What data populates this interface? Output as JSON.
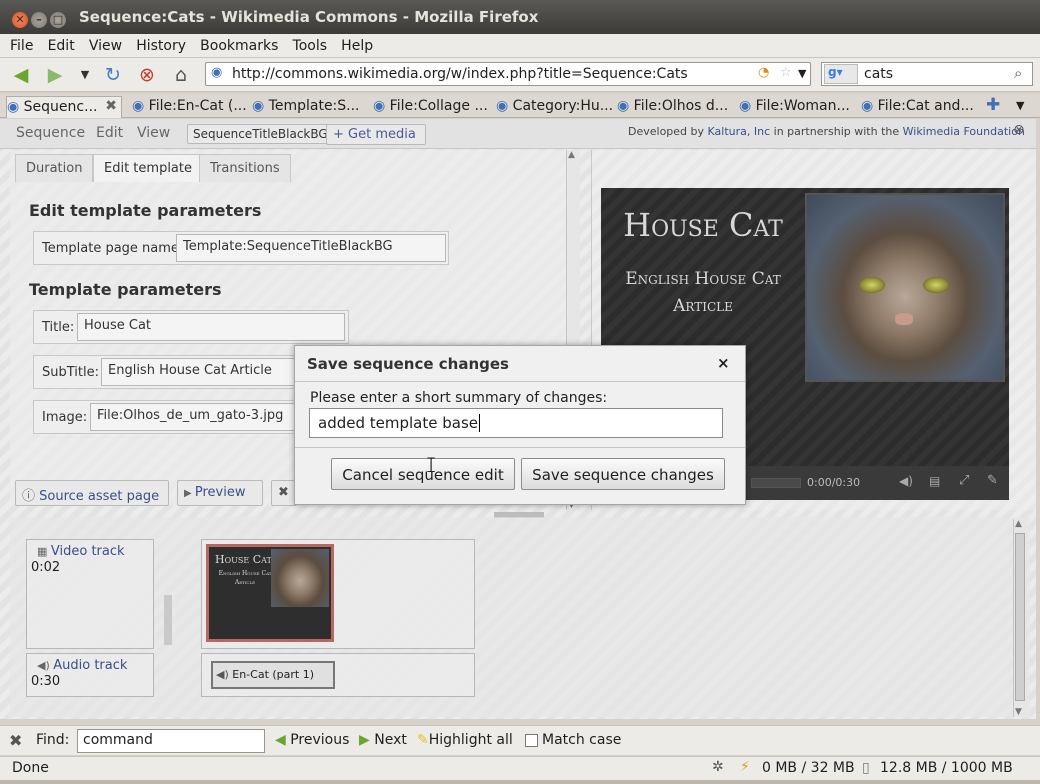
{
  "window": {
    "title": "Sequence:Cats - Wikimedia Commons - Mozilla Firefox"
  },
  "menu": [
    "File",
    "Edit",
    "View",
    "History",
    "Bookmarks",
    "Tools",
    "Help"
  ],
  "nav": {
    "url": "http://commons.wikimedia.org/w/index.php?title=Sequence:Cats",
    "search_value": "cats"
  },
  "tabs": [
    "Sequenc...",
    "File:En-Cat (...",
    "Template:S...",
    "File:Collage ...",
    "Category:Hu...",
    "File:Olhos d...",
    "File:Woman...",
    "File:Cat and..."
  ],
  "editor": {
    "menus": [
      "Sequence",
      "Edit",
      "View"
    ],
    "template_label": "SequenceTitleBlackBG",
    "get_media": "+ Get media",
    "credit": {
      "prefix": "Developed by",
      "kaltura": "Kaltura, Inc",
      "middle": "in partnership with the",
      "wmf": "Wikimedia Foundation"
    },
    "subtabs": [
      "Duration",
      "Edit template",
      "Transitions"
    ],
    "heading1": "Edit template parameters",
    "template_page_label": "Template page name",
    "template_page_value": "Template:SequenceTitleBlackBG",
    "heading2": "Template parameters",
    "params": [
      {
        "label": "Title:",
        "value": "House Cat"
      },
      {
        "label": "SubTitle:",
        "value": "English House Cat Article"
      },
      {
        "label": "Image:",
        "value": "File:Olhos_de_um_gato-3.jpg"
      }
    ],
    "source_asset": "Source asset page",
    "preview_btn": "Preview"
  },
  "player": {
    "title": "House Cat",
    "subtitle": "English House Cat Article",
    "time": "0:00/0:30"
  },
  "timeline": {
    "video_track": "Video track",
    "video_time": "0:02",
    "audio_track": "Audio track",
    "audio_time": "0:30",
    "clip_title": "House Cat",
    "clip_subtitle": "English House Cat Article",
    "audio_clip": "En-Cat (part 1)"
  },
  "dialog": {
    "title": "Save sequence changes",
    "prompt": "Please enter a short summary of changes:",
    "input": "added template base",
    "cancel": "Cancel sequence edit",
    "save": "Save sequence changes"
  },
  "find": {
    "label": "Find:",
    "value": "command",
    "previous": "Previous",
    "next": "Next",
    "highlight": "Highlight all",
    "match_case": "Match case"
  },
  "status": {
    "text": "Done",
    "mem1": "0 MB / 32 MB",
    "mem2": "12.8 MB / 1000 MB"
  }
}
